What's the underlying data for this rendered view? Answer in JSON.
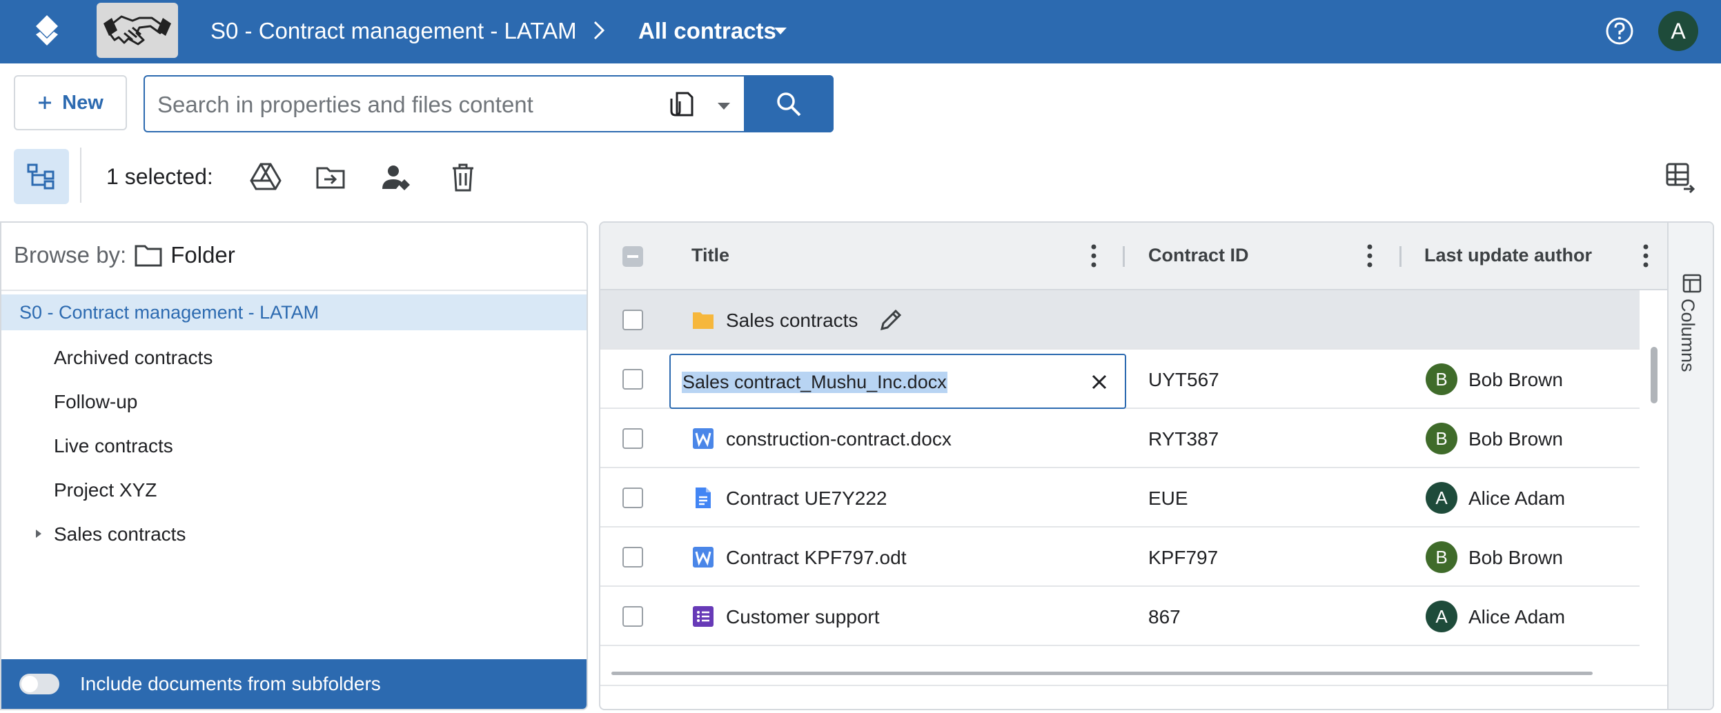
{
  "header": {
    "breadcrumb_root": "S0 - Contract management - LATAM",
    "breadcrumb_current": "All contracts",
    "avatar_letter": "A",
    "brand_color": "#2c6ab0"
  },
  "toolbar": {
    "new_label": "New",
    "search_placeholder": "Search in properties and files content",
    "selected_label": "1 selected:"
  },
  "left_panel": {
    "browse_label": "Browse by:",
    "browse_value": "Folder",
    "tree_root": "S0 - Contract management - LATAM",
    "tree_items": [
      "Archived contracts",
      "Follow-up",
      "Live contracts",
      "Project XYZ",
      "Sales contracts"
    ],
    "subfolders_label": "Include documents from subfolders",
    "subfolders_on": false
  },
  "grid": {
    "columns": [
      "Title",
      "Contract ID",
      "Last update author"
    ],
    "folder_row": {
      "title": "Sales contracts",
      "icon": "folder-icon"
    },
    "rename_value": "Sales contract_Mushu_Inc.docx",
    "rows": [
      {
        "title": "Sales contract_Mushu_Inc.docx",
        "id": "UYT567",
        "author": "Bob Brown",
        "author_initial": "B",
        "icon": "word-icon",
        "editing": true
      },
      {
        "title": "construction-contract.docx",
        "id": "RYT387",
        "author": "Bob Brown",
        "author_initial": "B",
        "icon": "word-icon"
      },
      {
        "title": "Contract UE7Y222",
        "id": "EUE",
        "author": "Alice Adam",
        "author_initial": "A",
        "icon": "google-doc-icon"
      },
      {
        "title": "Contract KPF797.odt",
        "id": "KPF797",
        "author": "Bob Brown",
        "author_initial": "B",
        "icon": "word-icon"
      },
      {
        "title": "Customer support",
        "id": "867",
        "author": "Alice Adam",
        "author_initial": "A",
        "icon": "google-form-icon"
      }
    ],
    "columns_panel_label": "Columns",
    "avatar_colors": {
      "B": "#3f6b2a",
      "A": "#1e4b3a"
    }
  }
}
